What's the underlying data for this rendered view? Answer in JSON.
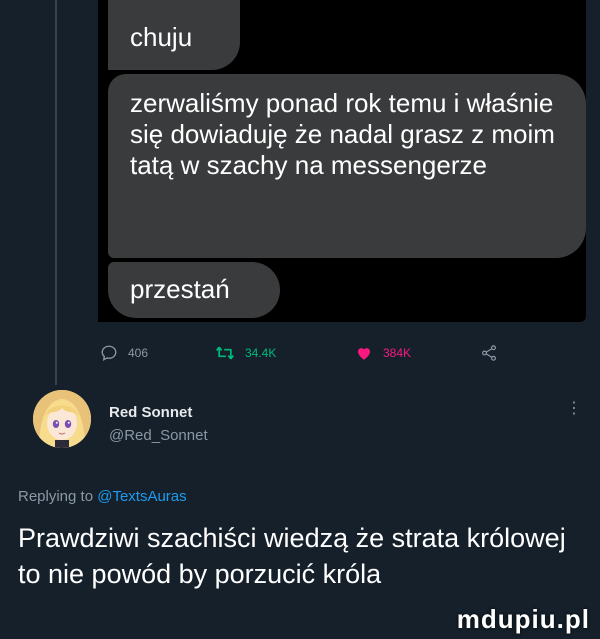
{
  "screenshot": {
    "messages": [
      "chuju",
      "zerwaliśmy ponad rok temu i właśnie się dowiaduję że nadal grasz z moim tatą w szachy na messengerze",
      "przestań"
    ]
  },
  "actions": {
    "reply_count": "406",
    "retweet_count": "34.4K",
    "like_count": "384K"
  },
  "reply": {
    "author_name": "Red Sonnet",
    "author_handle": "@Red_Sonnet",
    "replying_prefix": "Replying to",
    "replying_to": "@TextsAuras",
    "text": "Prawdziwi szachiści wiedzą że strata królowej to nie powód by porzucić króla"
  },
  "watermark": "mdupiu.pl",
  "colors": {
    "background": "#15202b",
    "bubble": "#3a3b3c",
    "retweet": "#00ba7c",
    "like": "#f91880",
    "link": "#1d9bf0",
    "muted": "#8b98a5"
  },
  "icons": [
    "reply-icon",
    "retweet-icon",
    "heart-icon",
    "share-icon",
    "more-icon"
  ]
}
